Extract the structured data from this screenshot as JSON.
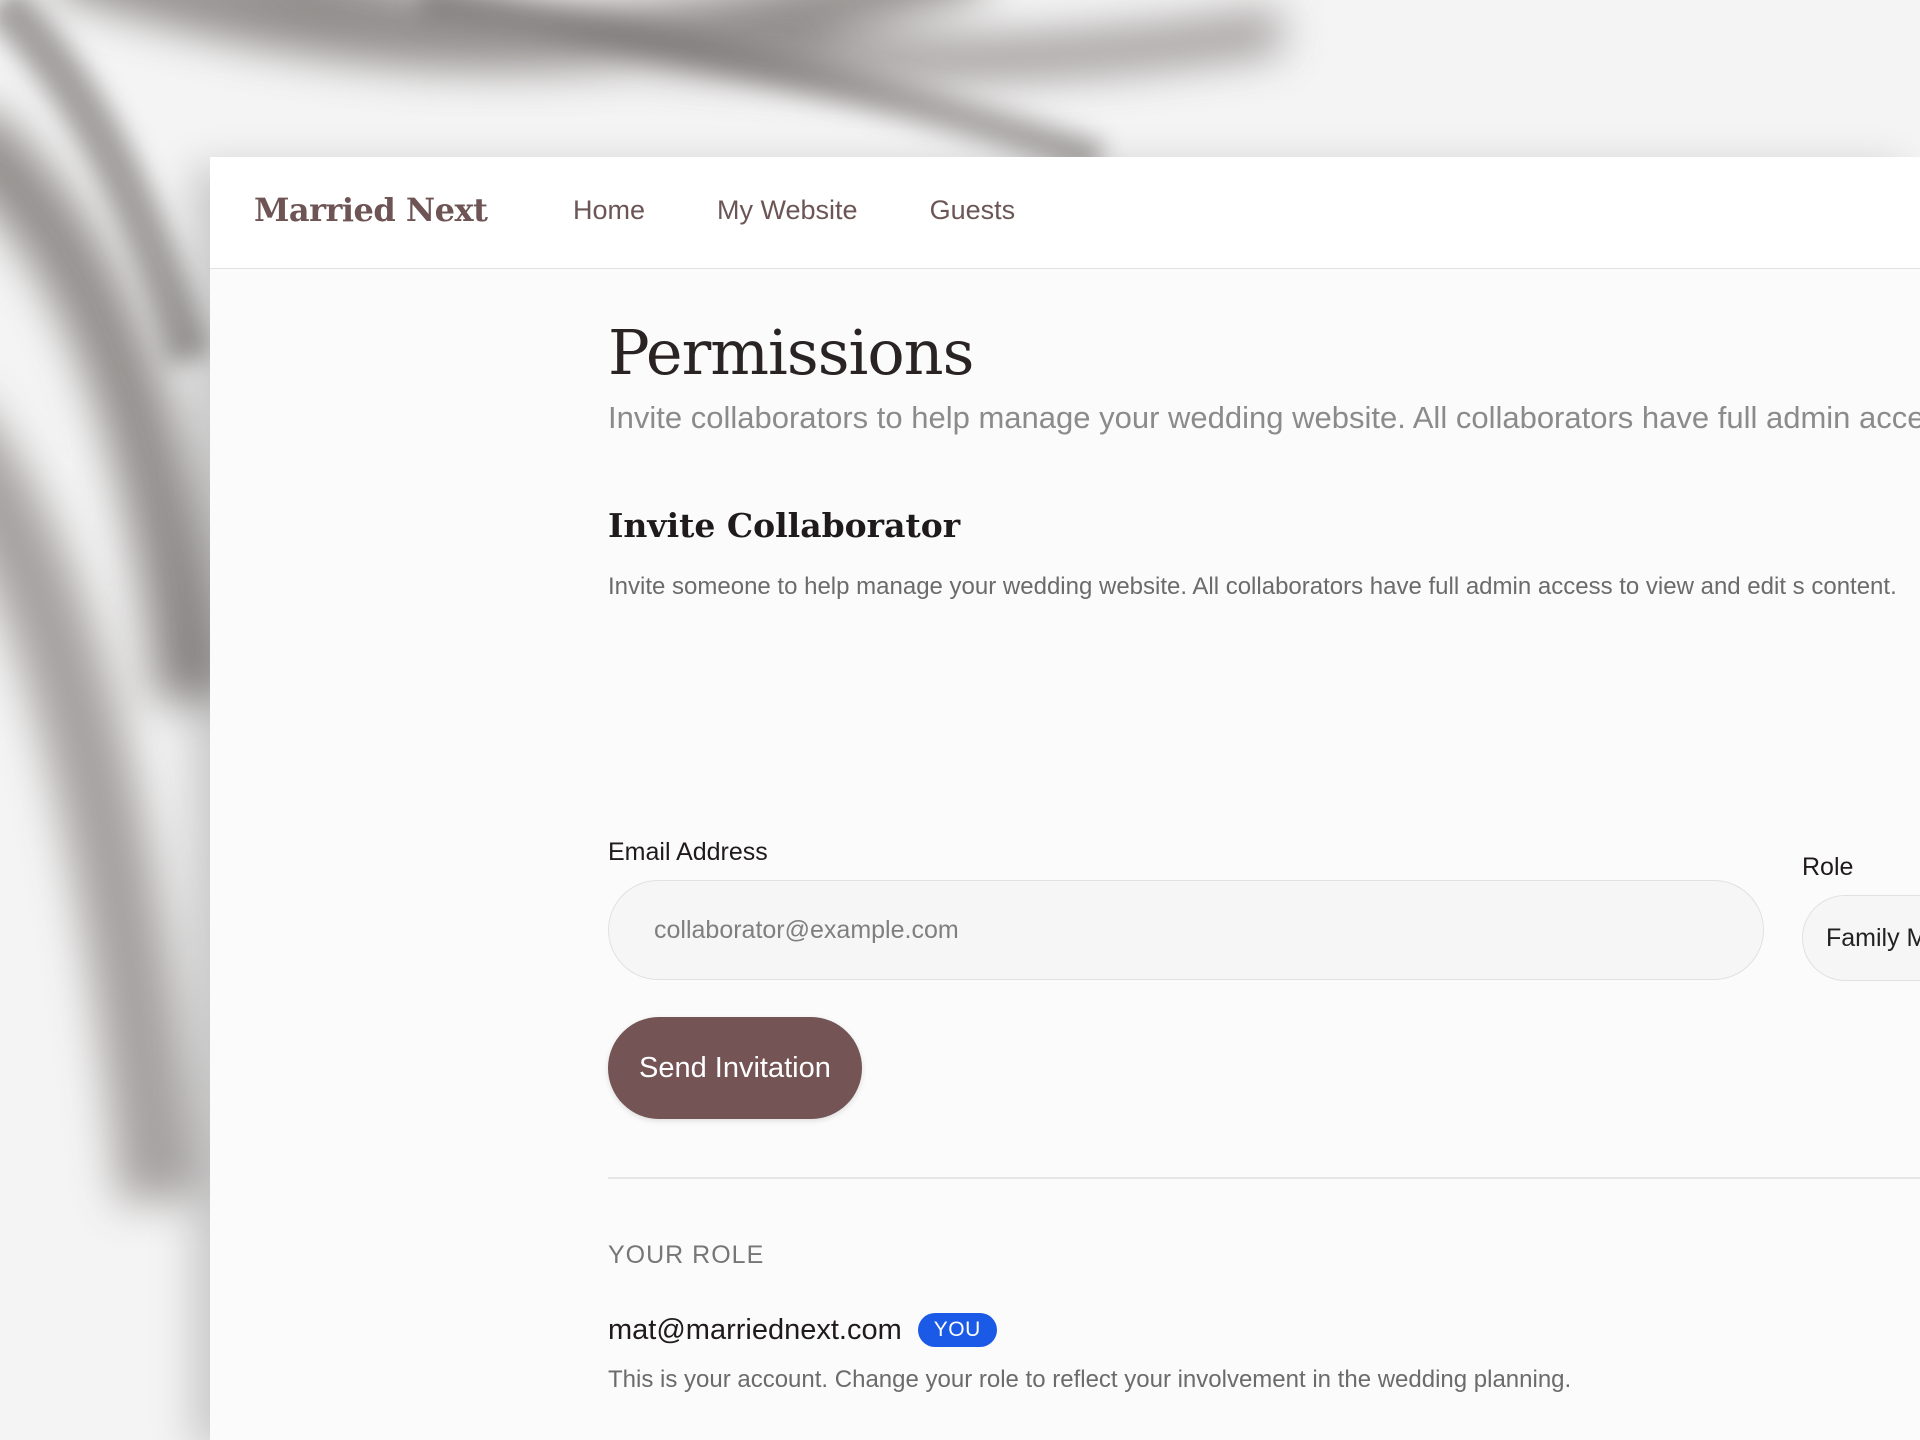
{
  "app": {
    "brand": "Married Next"
  },
  "nav": {
    "items": [
      {
        "label": "Home"
      },
      {
        "label": "My Website"
      },
      {
        "label": "Guests"
      }
    ]
  },
  "page": {
    "title": "Permissions",
    "subtitle": "Invite collaborators to help manage your wedding website. All collaborators have full admin acce"
  },
  "invite": {
    "title": "Invite Collaborator",
    "description": "Invite someone to help manage your wedding website. All collaborators have full admin access to view and edit s content.",
    "email_label": "Email Address",
    "email_placeholder": "collaborator@example.com",
    "email_value": "",
    "role_label": "Role",
    "role_value": "Family M",
    "send_label": "Send Invitation"
  },
  "your_role": {
    "heading": "YOUR ROLE",
    "email": "mat@marriednext.com",
    "badge": "YOU",
    "description": "This is your account. Change your role to reflect your involvement in the wedding planning."
  },
  "colors": {
    "brand": "#6e5454",
    "primary_button": "#745454",
    "badge": "#1a5ae6"
  }
}
